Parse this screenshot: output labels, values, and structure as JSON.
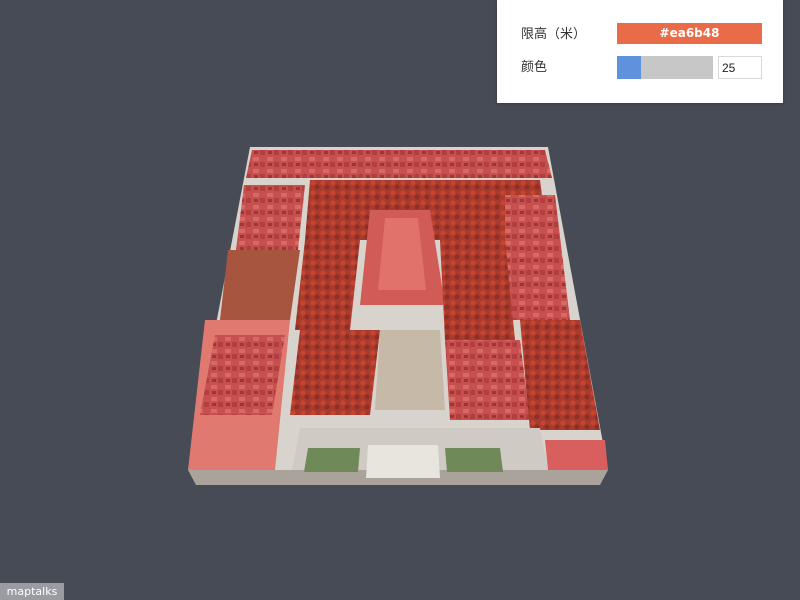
{
  "panel": {
    "height_label": "限高（米）",
    "color_label": "颜色",
    "height_color_value": "#ea6b48",
    "height_color": "#ea6b48",
    "color_slider_value": "25",
    "color_slider_fraction": 0.25
  },
  "viewport": {
    "background": "#474b55"
  },
  "watermark": {
    "text": "maptalks"
  }
}
